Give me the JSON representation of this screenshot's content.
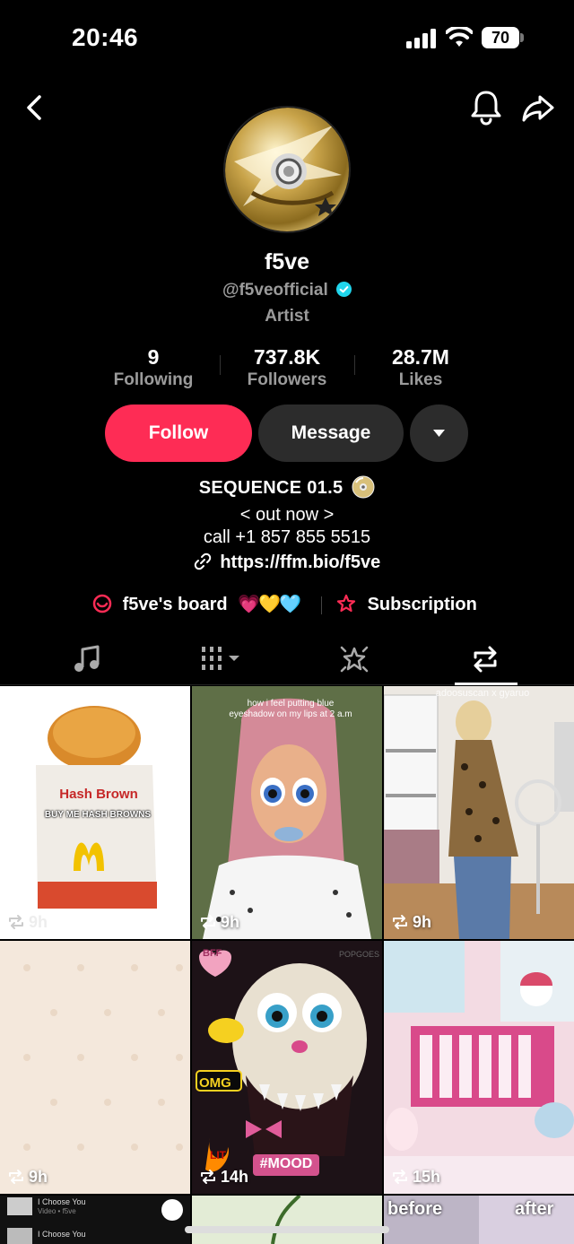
{
  "status": {
    "time": "20:46",
    "battery": "70"
  },
  "profile": {
    "name": "f5ve",
    "handle": "@f5veofficial",
    "category": "Artist",
    "stats": [
      {
        "value": "9",
        "label": "Following"
      },
      {
        "value": "737.8K",
        "label": "Followers"
      },
      {
        "value": "28.7M",
        "label": "Likes"
      }
    ],
    "follow_label": "Follow",
    "message_label": "Message",
    "bio": {
      "title": "SEQUENCE 01.5",
      "line2": "< out now >",
      "line3": "call +1 857 855 5515",
      "link": "https://ffm.bio/f5ve"
    },
    "board_label": "f5ve's board",
    "board_emojis": "💗💛🩵",
    "subscription_label": "Subscription"
  },
  "grid": [
    {
      "time": "9h",
      "overlay": "Hash Brown",
      "subtext": "BUY ME HASH BROWNS"
    },
    {
      "time": "9h",
      "overlay": "how i feel putting blue eyeshadow on my lips at 2 a.m"
    },
    {
      "time": "9h",
      "overlay": "adoosuscan x gyaruo"
    },
    {
      "time": "9h"
    },
    {
      "time": "14h",
      "stickers": [
        "BFF",
        "OMG",
        "LIT",
        "#MOOD"
      ],
      "watermark": "POPGOES"
    },
    {
      "time": "15h"
    },
    {
      "list": [
        "I Choose You",
        "I Choose You"
      ],
      "sub": "Video • f5ve"
    },
    {},
    {
      "overlay_left": "before",
      "overlay_right": "after"
    }
  ],
  "colors": {
    "accent": "#fe2c55",
    "verified": "#20d5ec"
  }
}
